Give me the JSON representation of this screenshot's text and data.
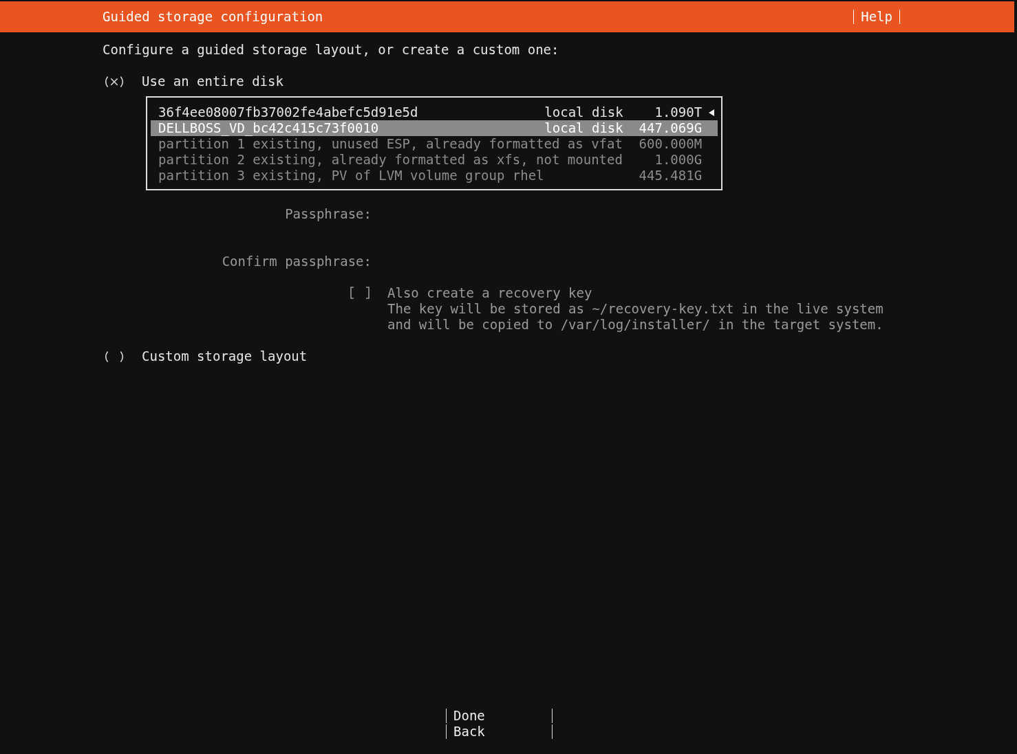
{
  "header": {
    "title": "Guided storage configuration",
    "help": "Help"
  },
  "intro": "Configure a guided storage layout, or create a custom one:",
  "entire_disk": {
    "label": "Use an entire disk",
    "selected": true
  },
  "disks": [
    {
      "kind": "disk",
      "name": "36f4ee08007fb37002fe4abefc5d91e5d",
      "type": "local disk",
      "size": "1.090T",
      "selected": false,
      "has_menu": true
    },
    {
      "kind": "disk",
      "name": "DELLBOSS_VD_bc42c415c73f0010",
      "type": "local disk",
      "size": "447.069G",
      "selected": true,
      "has_menu": false
    },
    {
      "kind": "partition",
      "name": "partition 1 existing, unused ESP, already formatted as vfat",
      "size": "600.000M",
      "selected": false,
      "has_menu": false
    },
    {
      "kind": "partition",
      "name": "partition 2 existing, already formatted as xfs, not mounted",
      "size": "1.000G",
      "selected": false,
      "has_menu": false
    },
    {
      "kind": "partition",
      "name": "partition 3 existing, PV of LVM volume group rhel",
      "size": "445.481G",
      "selected": false,
      "has_menu": false
    }
  ],
  "passphrase_fields": [
    {
      "label": "Passphrase:",
      "disabled": true
    },
    {
      "label": "Confirm passphrase:",
      "disabled": true
    }
  ],
  "recovery_key": {
    "label": "Also create a recovery key",
    "checked": false,
    "disabled": true,
    "help": [
      "The key will be stored as ~/recovery-key.txt in the live system",
      "and will be copied to /var/log/installer/ in the target system."
    ]
  },
  "custom_layout": {
    "label": "Custom storage layout",
    "selected": false
  },
  "buttons": [
    "Done",
    "Back"
  ]
}
